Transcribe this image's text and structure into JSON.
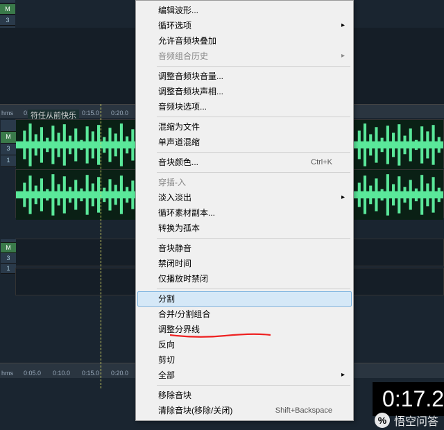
{
  "track_label": "符任从前快乐",
  "ruler_top": {
    "hms": "hms",
    "ticks": [
      "0:05.0",
      "0:10.0",
      "0:15.0",
      "0:20.0"
    ]
  },
  "ruler_bottom": {
    "hms": "hms",
    "ticks": [
      "0:05.0",
      "0:10.0",
      "0:15.0",
      "0:20.0"
    ]
  },
  "left_buttons_top": [
    "",
    "M",
    "3",
    "1"
  ],
  "track_side_buttons": [
    "",
    "M",
    "3",
    "1"
  ],
  "time_display": "0:17.2",
  "watermark": "悟空问答",
  "menu": {
    "items": [
      {
        "label": "编辑波形...",
        "type": "item"
      },
      {
        "label": "循环选项",
        "type": "submenu"
      },
      {
        "label": "允许音频块叠加",
        "type": "item"
      },
      {
        "label": "音频组合历史",
        "type": "submenu",
        "disabled": true
      },
      {
        "type": "sep"
      },
      {
        "label": "调整音频块音量...",
        "type": "item"
      },
      {
        "label": "调整音频块声相...",
        "type": "item"
      },
      {
        "label": "音频块选项...",
        "type": "item"
      },
      {
        "type": "sep"
      },
      {
        "label": "混缩为文件",
        "type": "item"
      },
      {
        "label": "单声道混缩",
        "type": "item"
      },
      {
        "type": "sep"
      },
      {
        "label": "音块颜色...",
        "shortcut": "Ctrl+K",
        "type": "item"
      },
      {
        "type": "sep"
      },
      {
        "label": "穿插-入",
        "type": "item",
        "disabled": true
      },
      {
        "label": "淡入淡出",
        "type": "submenu"
      },
      {
        "label": "循环素材副本...",
        "type": "item"
      },
      {
        "label": "转换为孤本",
        "type": "item"
      },
      {
        "type": "sep"
      },
      {
        "label": "音块静音",
        "type": "item"
      },
      {
        "label": "禁闭时间",
        "type": "item"
      },
      {
        "label": "仅播放时禁闭",
        "type": "item"
      },
      {
        "type": "sep"
      },
      {
        "label": "分割",
        "type": "item",
        "highlighted": true
      },
      {
        "label": "合并/分割组合",
        "type": "item"
      },
      {
        "label": "调整分界线",
        "type": "item"
      },
      {
        "label": "反向",
        "type": "item"
      },
      {
        "label": "剪切",
        "type": "item"
      },
      {
        "label": "全部",
        "type": "submenu"
      },
      {
        "type": "sep"
      },
      {
        "label": "移除音块",
        "type": "item"
      },
      {
        "label": "清除音块(移除/关闭)",
        "shortcut": "Shift+Backspace",
        "type": "item"
      }
    ]
  }
}
